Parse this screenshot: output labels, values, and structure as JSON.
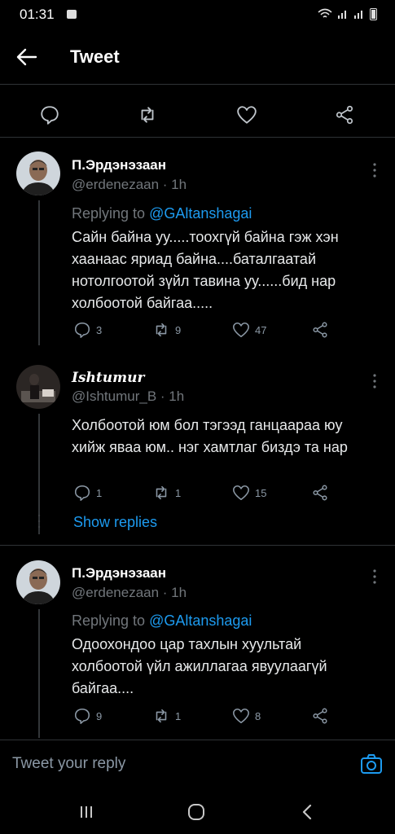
{
  "status_bar": {
    "time": "01:31",
    "icons": "📶 ..ıl ..ıl 🔋"
  },
  "header": {
    "title": "Tweet"
  },
  "tweets": [
    {
      "name": "П.Эрдэнэзаан",
      "handle": "@erdenezaan · 1h",
      "replying_prefix": "Replying to ",
      "replying_to": "@GAltanshagai",
      "text": "Сайн байна уу.....тоохгүй байна гэж хэн хаанаас яриад байна....баталгаатай нотолгоотой зүйл тавина уу......бид нар холбоотой байгаа.....",
      "replies": "3",
      "retweets": "9",
      "likes": "47"
    },
    {
      "name": "Ishtumur",
      "handle": "@Ishtumur_B · 1h",
      "text": "Холбоотой юм бол тэгээд ганцаараа юу хийж яваа юм.. нэг хамтлаг биздэ та нар",
      "replies": "1",
      "retweets": "1",
      "likes": "15"
    },
    {
      "name": "П.Эрдэнэзаан",
      "handle": "@erdenezaan · 1h",
      "replying_prefix": "Replying to ",
      "replying_to": "@GAltanshagai",
      "text": "Одоохондоо цар тахлын хуультай холбоотой үйл ажиллагаа явуулаагүй байгаа....",
      "replies": "9",
      "retweets": "1",
      "likes": "8"
    }
  ],
  "show_replies": "Show replies",
  "reply_bar": {
    "placeholder": "Tweet your reply"
  },
  "colors": {
    "accent": "#1d9bf0",
    "background": "#000000",
    "divider": "#2f3336"
  }
}
